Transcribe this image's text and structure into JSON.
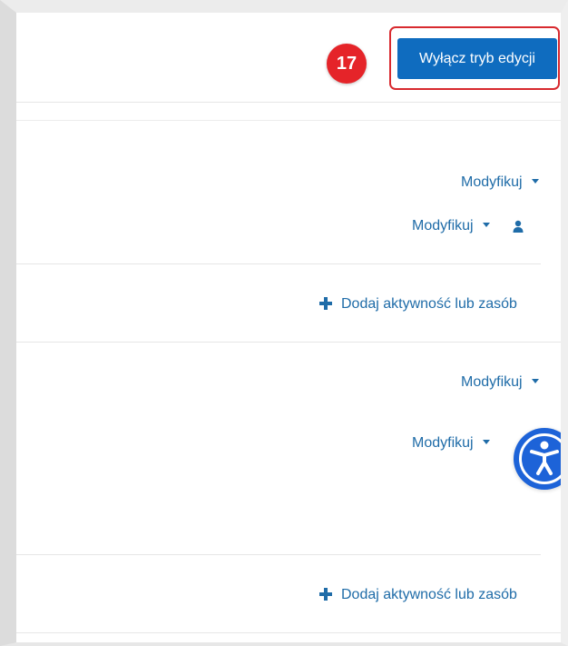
{
  "step_badge": "17",
  "edit_mode_button": {
    "label": "Wyłącz tryb edycji"
  },
  "sections": [
    {
      "modify_primary": "Modyfikuj",
      "modify_secondary": "Modyfikuj",
      "add_label": "Dodaj aktywność lub zasób"
    },
    {
      "modify_primary": "Modyfikuj",
      "modify_secondary": "Modyfikuj",
      "add_label": "Dodaj aktywność lub zasób"
    }
  ],
  "icons": {
    "user": "user-icon",
    "add": "plus-icon",
    "dropdown": "caret-down-icon",
    "accessibility": "accessibility-icon"
  },
  "colors": {
    "edit_button": "#0f6cbf",
    "badge": "#e52429",
    "link": "#1f6ca8",
    "accessibility_button": "#1d63d8",
    "highlight_frame": "#d82a2f"
  }
}
